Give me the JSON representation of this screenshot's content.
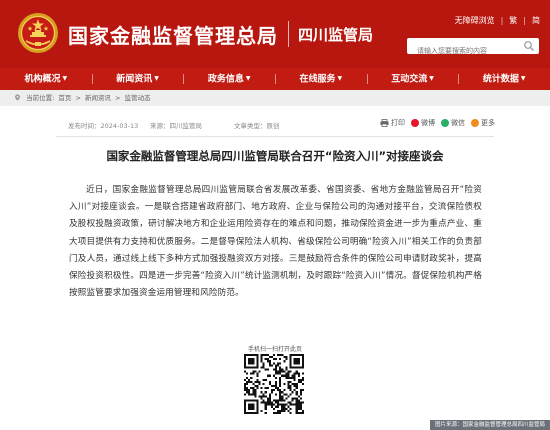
{
  "header": {
    "site_title": "国家金融监督管理总局",
    "branch_title": "四川监管局",
    "accessibility_link": "无障碍浏览",
    "lang_links": [
      "繁",
      "简"
    ],
    "search_placeholder": "请输入您要搜索的内容",
    "colors": {
      "header_bg": "#b8170f",
      "nav_bg": "#c11b12",
      "accent_gold": "#f4c430"
    }
  },
  "nav": {
    "items": [
      {
        "label": "机构概况"
      },
      {
        "label": "新闻资讯"
      },
      {
        "label": "政务信息"
      },
      {
        "label": "在线服务"
      },
      {
        "label": "互动交流"
      },
      {
        "label": "统计数据"
      }
    ]
  },
  "breadcrumb": {
    "prefix": "当前位置:",
    "items": [
      "首页",
      "新闻资讯",
      "监管动态"
    ],
    "separator": ">"
  },
  "meta": {
    "date_label": "发布时间：",
    "date": "2024-03-13",
    "source_label": "来源：",
    "source": "四川监管局",
    "type_label": "文章类型：",
    "type": "原创"
  },
  "share": {
    "items": [
      {
        "label": "打印",
        "icon": "print-icon"
      },
      {
        "label": "微博",
        "icon": "weibo-icon"
      },
      {
        "label": "微信",
        "icon": "wechat-icon"
      },
      {
        "label": "更多",
        "icon": "more-icon"
      }
    ]
  },
  "article": {
    "title": "国家金融监督管理总局四川监管局联合召开“险资入川”对接座谈会",
    "body": "近日，国家金融监督管理总局四川监管局联合省发展改革委、省国资委、省地方金融监管局召开“险资入川”对接座谈会。一是联合搭建省政府部门、地方政府、企业与保险公司的沟通对接平台，交流保险债权及股权投融资政策，研讨解决地方和企业运用险资存在的难点和问题，推动保险资金进一步为重点产业、重大项目提供有力支持和优质服务。二是督导保险法人机构、省级保险公司明确“险资入川”相关工作的负责部门及人员，通过线上线下多种方式加强投融资双方对接。三是鼓励符合条件的保险公司申请财政奖补，提高保险投资积极性。四是进一步完善“险资入川”统计监测机制，及时跟踪“险资入川”情况。督促保险机构严格按照监管要求加强资金运用管理和风险防范。"
  },
  "qr": {
    "caption": "手机扫一扫打开此页"
  },
  "footer": {
    "credit": "图片来源：国家金融监督管理总局四川监管局"
  }
}
